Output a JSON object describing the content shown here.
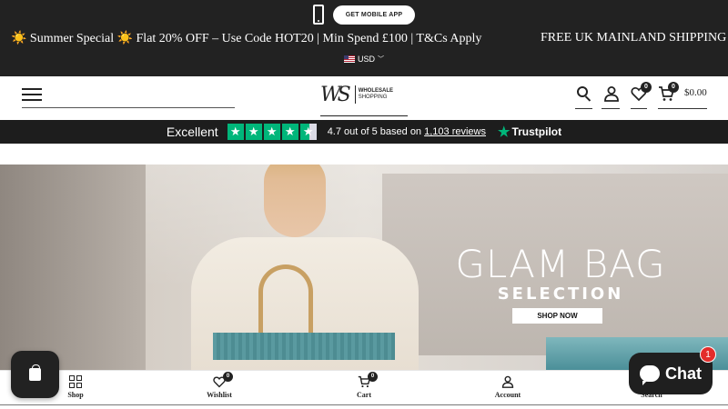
{
  "topbar": {
    "app_button": "GET MOBILE APP",
    "promo_left": "☀️ Summer Special ☀️ Flat 20% OFF – Use Code HOT20 | Min Spend £100 | T&Cs Apply",
    "promo_right": "FREE UK MAINLAND SHIPPING O",
    "currency": "USD"
  },
  "header": {
    "logo_mark": "WS",
    "logo_line1": "WHOLESALE",
    "logo_line2": "SHOPPING",
    "wishlist_count": "0",
    "cart_count": "0",
    "cart_total": "$0.00"
  },
  "trustpilot": {
    "rating_word": "Excellent",
    "text_before": "4.7 out of 5 based on ",
    "reviews_link": "1,103 reviews",
    "brand": "Trustpilot",
    "rating": 4.7
  },
  "hero": {
    "title": "GLAM BAG",
    "subtitle": "SELECTION",
    "cta": "SHOP NOW"
  },
  "bottom_nav": {
    "items": [
      {
        "label": "Shop"
      },
      {
        "label": "Wishlist",
        "badge": "0"
      },
      {
        "label": "Cart",
        "badge": "0"
      },
      {
        "label": "Account"
      },
      {
        "label": "Search"
      }
    ]
  },
  "chat": {
    "label": "Chat",
    "badge": "1"
  },
  "colors": {
    "topbar_bg": "#222222",
    "trustpilot_green": "#00b67a",
    "chat_badge": "#e32c2b"
  }
}
